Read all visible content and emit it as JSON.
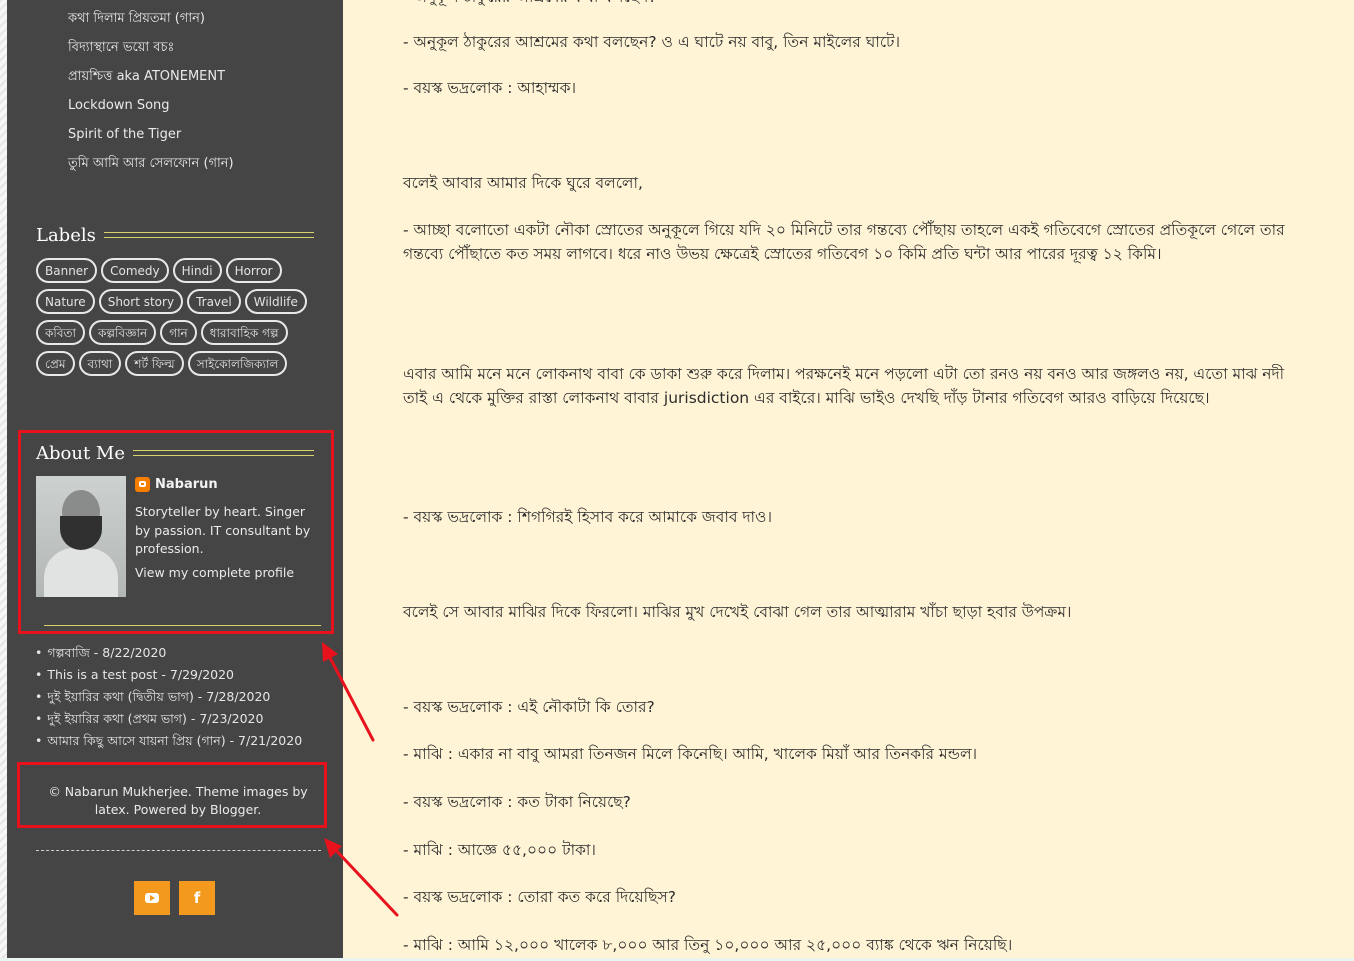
{
  "sidebar": {
    "top_links": [
      "কথা দিলাম প্রিয়তমা (গান)",
      "বিদ্যাস্থানে ভয়ো বচঃ",
      "প্রায়শ্চিত্ত aka ATONEMENT",
      "Lockdown Song",
      "Spirit of the Tiger",
      "তুমি আমি আর সেলফোন (গান)"
    ],
    "labels_title": "Labels",
    "labels": [
      "Banner",
      "Comedy",
      "Hindi",
      "Horror",
      "Nature",
      "Short story",
      "Travel",
      "Wildlife",
      "কবিতা",
      "কল্পবিজ্ঞান",
      "গান",
      "ধারাবাহিক গল্প",
      "প্রেম",
      "ব্যাথা",
      "শর্ট ফিল্ম",
      "সাইকোলজিক্যাল"
    ],
    "about": {
      "title": "About Me",
      "name": "Nabarun",
      "description": "Storyteller by heart. Singer by passion. IT consultant by profession.",
      "profile_link": "View my complete profile"
    },
    "recent_posts": [
      "গল্পবাজি - 8/22/2020",
      "This is a test post - 7/29/2020",
      "দুই ইয়ারির কথা (দ্বিতীয় ভাগ) - 7/28/2020",
      "দুই ইয়ারির কথা (প্রথম ভাগ) - 7/23/2020",
      "আমার কিছু আসে যায়না প্রিয় (গান) - 7/21/2020"
    ],
    "footer": {
      "line1": "© Nabarun Mukherjee. Theme images by",
      "line2": "latex. Powered by Blogger."
    },
    "social": [
      {
        "name": "youtube-icon"
      },
      {
        "name": "facebook-icon",
        "glyph": "f"
      }
    ]
  },
  "post": {
    "paragraphs": [
      "- অনুকূল ঠাকুরের আশ্রমের কথা বলছেন?",
      "- অনুকূল ঠাকুরের আশ্রমের কথা বলছেন? ও এ ঘাটে নয় বাবু, তিন মাইলের ঘাটে।",
      "- বয়স্ক ভদ্রলোক : আহাম্মক।",
      "বলেই আবার আমার দিকে ঘুরে বললো,",
      "- আচ্ছা বলোতো একটা নৌকা স্রোতের অনুকূলে গিয়ে যদি ২০ মিনিটে তার গন্তব্যে পৌঁছায় তাহলে একই গতিবেগে স্রোতের প্রতিকূলে গেলে তার গন্তব্যে পৌঁছাতে কত সময় লাগবে। ধরে নাও উভয় ক্ষেত্রেই স্রোতের গতিবেগ ১০ কিমি প্রতি ঘন্টা আর পারের দূরত্ব ১২ কিমি।",
      "এবার আমি মনে মনে লোকনাথ বাবা কে ডাকা শুরু করে দিলাম। পরক্ষনেই মনে পড়লো এটা তো রনও নয় বনও আর জঙ্গলও নয়, এতো মাঝ নদী তাই এ থেকে মুক্তির রাস্তা লোকনাথ বাবার jurisdiction এর বাইরে। মাঝি ভাইও দেখছি দাঁড় টানার গতিবেগ আরও বাড়িয়ে দিয়েছে।",
      "- বয়স্ক ভদ্রলোক : শিগগিরই হিসাব করে আমাকে জবাব দাও।",
      "বলেই সে আবার মাঝির দিকে ফিরলো। মাঝির মুখ দেখেই বোঝা গেল তার আত্মারাম খাঁচা ছাড়া হবার উপক্রম।",
      "- বয়স্ক ভদ্রলোক : এই নৌকাটা কি তোর?",
      "- মাঝি : একার না বাবু আমরা তিনজন মিলে কিনেছি। আমি, খালেক মিয়াঁ আর তিনকরি মন্ডল।",
      "- বয়স্ক ভদ্রলোক : কত টাকা নিয়েছে?",
      "- মাঝি : আজ্ঞে ৫৫,০০০ টাকা।",
      "- বয়স্ক ভদ্রলোক : তোরা কত করে দিয়েছিস?",
      "- মাঝি : আমি ১২,০০০ খালেক ৮,০০০ আর তিনু ১০,০০০ আর ২৫,০০০ ব্যাঙ্ক থেকে ঋন নিয়েছি।"
    ]
  },
  "colors": {
    "sidebar_bg": "#454545",
    "main_bg": "#fff4d6",
    "annotation_red": "#e8121c",
    "social_orange": "#f39a1e",
    "title_rule": "#d9d36a"
  }
}
